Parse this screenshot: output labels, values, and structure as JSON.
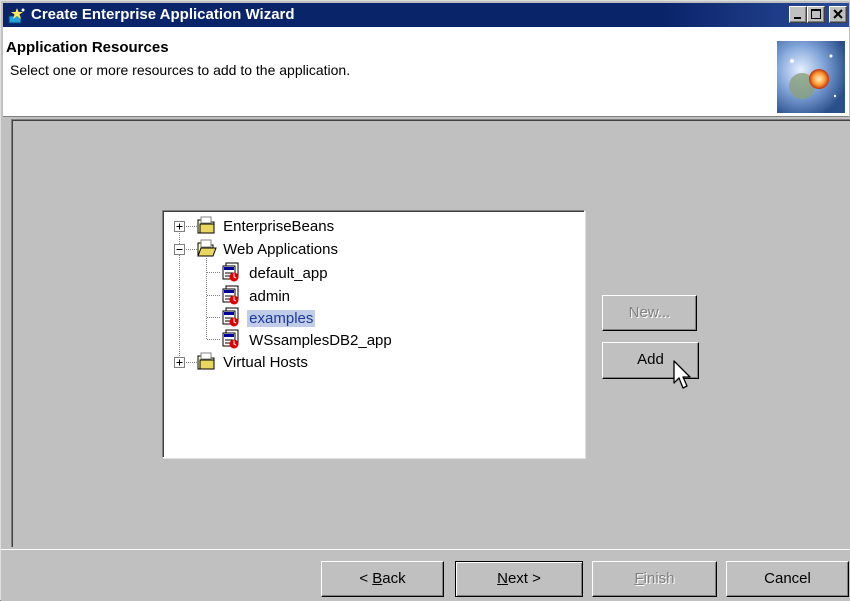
{
  "window": {
    "title": "Create Enterprise Application Wizard",
    "title_bar_color": "#0a246a"
  },
  "header": {
    "title": "Application Resources",
    "subtitle": "Select one or more resources to add to the application."
  },
  "tree": {
    "nodes": [
      {
        "label": "EnterpriseBeans",
        "icon": "folder-icon",
        "expander": "plus"
      },
      {
        "label": "Web Applications",
        "icon": "open-folder-icon",
        "expander": "minus"
      },
      {
        "label": "default_app",
        "icon": "web-app-icon"
      },
      {
        "label": "admin",
        "icon": "web-app-icon"
      },
      {
        "label": "examples",
        "icon": "web-app-icon",
        "selected": true
      },
      {
        "label": "WSsamplesDB2_app",
        "icon": "web-app-icon"
      },
      {
        "label": "Virtual Hosts",
        "icon": "folder-icon",
        "expander": "plus"
      }
    ],
    "selection_color": "#c0cce8"
  },
  "side_buttons": {
    "new": "New...",
    "add": "Add"
  },
  "footer": {
    "back_prefix": "< ",
    "back_mnemonic": "B",
    "back_rest": "ack",
    "next_mnemonic": "N",
    "next_rest": "ext >",
    "finish_mnemonic": "F",
    "finish_rest": "inish",
    "cancel": "Cancel"
  }
}
